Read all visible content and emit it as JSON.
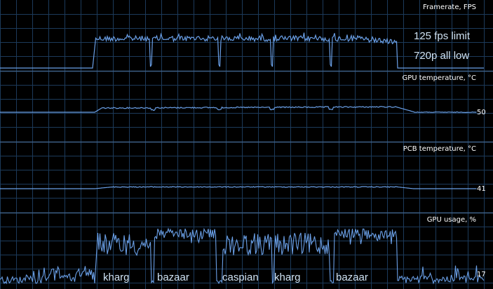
{
  "colors": {
    "background": "#000000",
    "grid": "#1c3a5a",
    "separator": "#3d5f86",
    "line": "#6a9fe6",
    "text": "#ffffff",
    "annotation": "#cfe2f3"
  },
  "chart_data": [
    {
      "type": "line",
      "title": "Framerate, FPS",
      "value_label": "",
      "annotations": [
        "125 fps limit",
        "720p all low"
      ],
      "grid": true,
      "x": [
        0,
        4,
        8,
        12,
        16,
        20,
        24,
        28,
        32,
        36,
        40,
        44,
        48,
        52,
        56,
        60,
        64,
        68,
        72,
        76,
        80,
        84,
        88,
        92,
        96,
        100
      ],
      "values": [
        0,
        0,
        0,
        0,
        0,
        0,
        0,
        0,
        0,
        0,
        0,
        0,
        0,
        0,
        0,
        0,
        0,
        0,
        0,
        0,
        0,
        0,
        0,
        0,
        0,
        0
      ],
      "path_y": [
        97,
        97,
        97,
        97,
        97,
        97,
        97,
        97,
        97,
        97,
        97,
        97,
        97,
        97,
        97,
        97,
        97,
        97,
        97,
        97,
        97,
        97,
        97,
        97,
        97,
        97
      ]
    }
  ]
}
